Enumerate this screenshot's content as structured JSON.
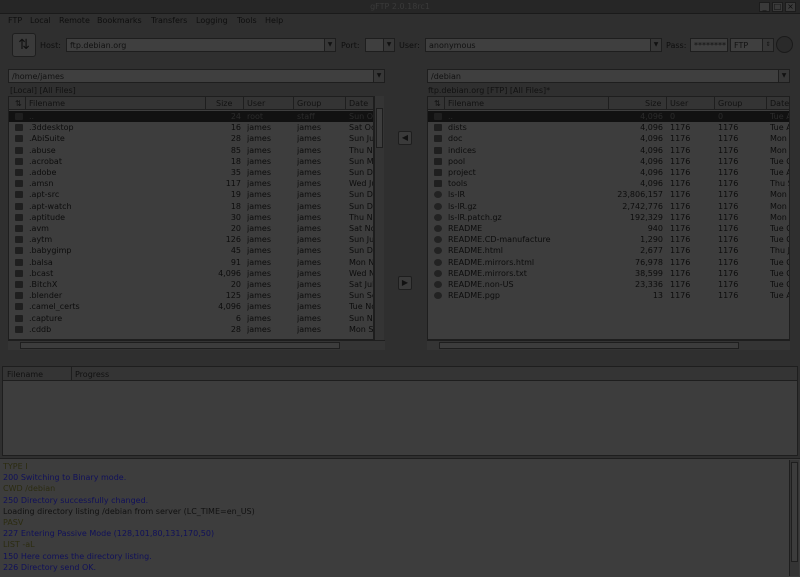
{
  "window": {
    "title": "gFTP 2.0.18rc1"
  },
  "menu": [
    "FTP",
    "Local",
    "Remote",
    "Bookmarks",
    "Transfers",
    "Logging",
    "Tools",
    "Help"
  ],
  "toolbar": {
    "host_label": "Host:",
    "host_value": "ftp.debian.org",
    "port_label": "Port:",
    "port_value": "",
    "user_label": "User:",
    "user_value": "anonymous",
    "pass_label": "Pass:",
    "pass_value": "********",
    "protocol": "FTP"
  },
  "local": {
    "path": "/home/james",
    "status": "[Local] [All Files]",
    "columns": [
      "Filename",
      "Size",
      "User",
      "Group",
      "Date"
    ],
    "rows": [
      {
        "name": "..",
        "size": "24",
        "user": "root",
        "group": "staff",
        "date": "Sun Oct",
        "type": "dir"
      },
      {
        "name": ".3ddesktop",
        "size": "16",
        "user": "james",
        "group": "james",
        "date": "Sat Oct",
        "type": "dir"
      },
      {
        "name": ".AbiSuite",
        "size": "28",
        "user": "james",
        "group": "james",
        "date": "Sun Jul",
        "type": "dir"
      },
      {
        "name": ".abuse",
        "size": "85",
        "user": "james",
        "group": "james",
        "date": "Thu Nov",
        "type": "dir"
      },
      {
        "name": ".acrobat",
        "size": "18",
        "user": "james",
        "group": "james",
        "date": "Sun Ma",
        "type": "dir"
      },
      {
        "name": ".adobe",
        "size": "35",
        "user": "james",
        "group": "james",
        "date": "Sun Dec",
        "type": "dir"
      },
      {
        "name": ".amsn",
        "size": "117",
        "user": "james",
        "group": "james",
        "date": "Wed Jun",
        "type": "dir"
      },
      {
        "name": ".apt-src",
        "size": "19",
        "user": "james",
        "group": "james",
        "date": "Sun Dec",
        "type": "dir"
      },
      {
        "name": ".apt-watch",
        "size": "18",
        "user": "james",
        "group": "james",
        "date": "Sun Dec",
        "type": "dir"
      },
      {
        "name": ".aptitude",
        "size": "30",
        "user": "james",
        "group": "james",
        "date": "Thu Nov",
        "type": "dir"
      },
      {
        "name": ".avm",
        "size": "20",
        "user": "james",
        "group": "james",
        "date": "Sat Nov",
        "type": "dir"
      },
      {
        "name": ".aytm",
        "size": "126",
        "user": "james",
        "group": "james",
        "date": "Sun Jun",
        "type": "dir"
      },
      {
        "name": ".babygimp",
        "size": "45",
        "user": "james",
        "group": "james",
        "date": "Sun Dec",
        "type": "dir"
      },
      {
        "name": ".balsa",
        "size": "91",
        "user": "james",
        "group": "james",
        "date": "Mon No",
        "type": "dir"
      },
      {
        "name": ".bcast",
        "size": "4,096",
        "user": "james",
        "group": "james",
        "date": "Wed Nov",
        "type": "dir"
      },
      {
        "name": ".BitchX",
        "size": "20",
        "user": "james",
        "group": "james",
        "date": "Sat Jul 2",
        "type": "dir"
      },
      {
        "name": ".blender",
        "size": "125",
        "user": "james",
        "group": "james",
        "date": "Sun Sep",
        "type": "dir"
      },
      {
        "name": ".camel_certs",
        "size": "4,096",
        "user": "james",
        "group": "james",
        "date": "Tue Nov",
        "type": "dir"
      },
      {
        "name": ".capture",
        "size": "6",
        "user": "james",
        "group": "james",
        "date": "Sun Nov",
        "type": "dir"
      },
      {
        "name": ".cddb",
        "size": "28",
        "user": "james",
        "group": "james",
        "date": "Mon Se",
        "type": "dir"
      }
    ]
  },
  "remote": {
    "path": "/debian",
    "status": "ftp.debian.org [FTP] [All Files]*",
    "columns": [
      "Filename",
      "Size",
      "User",
      "Group",
      "Date"
    ],
    "rows": [
      {
        "name": "..",
        "size": "4,096",
        "user": "0",
        "group": "0",
        "date": "Tue A",
        "type": "dir"
      },
      {
        "name": "dists",
        "size": "4,096",
        "user": "1176",
        "group": "1176",
        "date": "Tue A",
        "type": "dir"
      },
      {
        "name": "doc",
        "size": "4,096",
        "user": "1176",
        "group": "1176",
        "date": "Mon",
        "type": "dir"
      },
      {
        "name": "indices",
        "size": "4,096",
        "user": "1176",
        "group": "1176",
        "date": "Mon",
        "type": "dir"
      },
      {
        "name": "pool",
        "size": "4,096",
        "user": "1176",
        "group": "1176",
        "date": "Tue O",
        "type": "dir"
      },
      {
        "name": "project",
        "size": "4,096",
        "user": "1176",
        "group": "1176",
        "date": "Tue A",
        "type": "dir"
      },
      {
        "name": "tools",
        "size": "4,096",
        "user": "1176",
        "group": "1176",
        "date": "Thu S",
        "type": "dir"
      },
      {
        "name": "ls-lR",
        "size": "23,806,157",
        "user": "1176",
        "group": "1176",
        "date": "Mon",
        "type": "file"
      },
      {
        "name": "ls-lR.gz",
        "size": "2,742,776",
        "user": "1176",
        "group": "1176",
        "date": "Mon",
        "type": "file"
      },
      {
        "name": "ls-lR.patch.gz",
        "size": "192,329",
        "user": "1176",
        "group": "1176",
        "date": "Mon",
        "type": "file"
      },
      {
        "name": "README",
        "size": "940",
        "user": "1176",
        "group": "1176",
        "date": "Tue C",
        "type": "file"
      },
      {
        "name": "README.CD-manufacture",
        "size": "1,290",
        "user": "1176",
        "group": "1176",
        "date": "Tue C",
        "type": "file"
      },
      {
        "name": "README.html",
        "size": "2,677",
        "user": "1176",
        "group": "1176",
        "date": "Thu J",
        "type": "file"
      },
      {
        "name": "README.mirrors.html",
        "size": "76,978",
        "user": "1176",
        "group": "1176",
        "date": "Tue C",
        "type": "file"
      },
      {
        "name": "README.mirrors.txt",
        "size": "38,599",
        "user": "1176",
        "group": "1176",
        "date": "Tue C",
        "type": "file"
      },
      {
        "name": "README.non-US",
        "size": "23,336",
        "user": "1176",
        "group": "1176",
        "date": "Tue C",
        "type": "file"
      },
      {
        "name": "README.pgp",
        "size": "13",
        "user": "1176",
        "group": "1176",
        "date": "Tue A",
        "type": "file"
      }
    ]
  },
  "queue": {
    "columns": [
      "Filename",
      "Progress"
    ]
  },
  "log": [
    {
      "text": "TYPE I",
      "color": "#2b2b10"
    },
    {
      "text": "200 Switching to Binary mode.",
      "color": "#10105a"
    },
    {
      "text": "CWD /debian",
      "color": "#2b2b10"
    },
    {
      "text": "250 Directory successfully changed.",
      "color": "#10105a"
    },
    {
      "text": "Loading directory listing /debian from server (LC_TIME=en_US)",
      "color": "#111111"
    },
    {
      "text": "PASV",
      "color": "#2b2b10"
    },
    {
      "text": "227 Entering Passive Mode (128,101,80,131,170,50)",
      "color": "#10105a"
    },
    {
      "text": "LIST -aL",
      "color": "#2b2b10"
    },
    {
      "text": "150 Here comes the directory listing.",
      "color": "#10105a"
    },
    {
      "text": "226 Directory send OK.",
      "color": "#10105a"
    }
  ]
}
